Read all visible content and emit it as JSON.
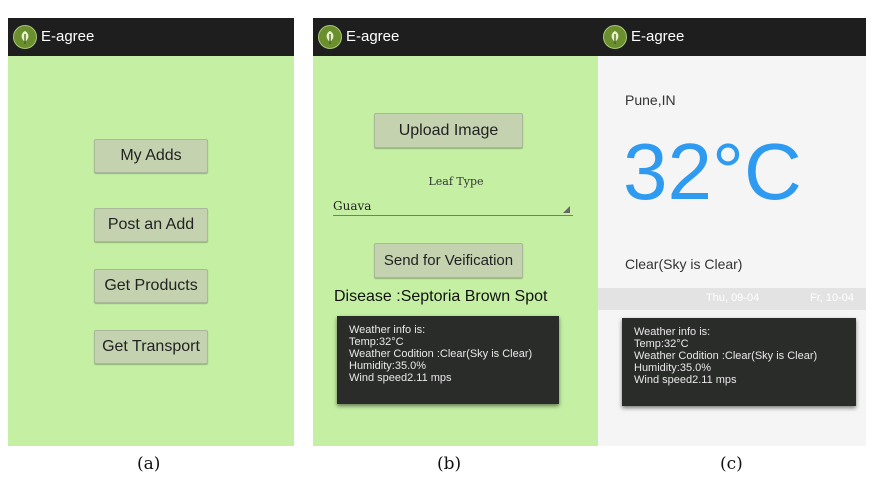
{
  "app_title": "E-agree",
  "screen_a": {
    "buttons": [
      "My Adds",
      "Post an Add",
      "Get Products",
      "Get Transport"
    ]
  },
  "screen_b": {
    "upload_button": "Upload Image",
    "leaf_type_label": "Leaf Type",
    "leaf_type_value": "Guava",
    "send_button": "Send for Veification",
    "disease_text": "Disease :Septoria Brown Spot",
    "weather_toast": [
      "Weather info is:",
      "Temp:32°C",
      "Weather Codition :Clear(Sky is Clear)",
      "Humidity:35.0%",
      "Wind speed2.11 mps"
    ]
  },
  "screen_c": {
    "city": "Pune,IN",
    "temperature": "32°C",
    "condition": "Clear(Sky is Clear)",
    "days": [
      "Thu, 09-04",
      "Fr, 10-04"
    ],
    "weather_toast": [
      "Weather info is:",
      "Temp:32°C",
      "Weather Codition :Clear(Sky is Clear)",
      "Humidity:35.0%",
      "Wind speed2.11 mps"
    ]
  },
  "captions": {
    "a": "(a)",
    "b": "(b)",
    "c": "(c)"
  },
  "colors": {
    "screen_bg_green": "#c5f0a4",
    "action_bar": "#1e1e1e",
    "temperature_blue": "#2e9bf0",
    "toast_bg": "#2a2c2a"
  }
}
